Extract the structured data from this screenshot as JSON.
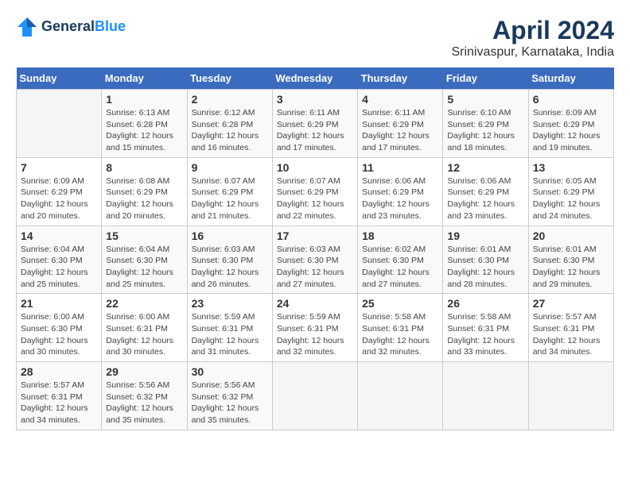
{
  "header": {
    "logo_line1": "General",
    "logo_line2": "Blue",
    "title": "April 2024",
    "subtitle": "Srinivaspur, Karnataka, India"
  },
  "calendar": {
    "days_of_week": [
      "Sunday",
      "Monday",
      "Tuesday",
      "Wednesday",
      "Thursday",
      "Friday",
      "Saturday"
    ],
    "weeks": [
      [
        {
          "day": "",
          "info": ""
        },
        {
          "day": "1",
          "info": "Sunrise: 6:13 AM\nSunset: 6:28 PM\nDaylight: 12 hours\nand 15 minutes."
        },
        {
          "day": "2",
          "info": "Sunrise: 6:12 AM\nSunset: 6:28 PM\nDaylight: 12 hours\nand 16 minutes."
        },
        {
          "day": "3",
          "info": "Sunrise: 6:11 AM\nSunset: 6:29 PM\nDaylight: 12 hours\nand 17 minutes."
        },
        {
          "day": "4",
          "info": "Sunrise: 6:11 AM\nSunset: 6:29 PM\nDaylight: 12 hours\nand 17 minutes."
        },
        {
          "day": "5",
          "info": "Sunrise: 6:10 AM\nSunset: 6:29 PM\nDaylight: 12 hours\nand 18 minutes."
        },
        {
          "day": "6",
          "info": "Sunrise: 6:09 AM\nSunset: 6:29 PM\nDaylight: 12 hours\nand 19 minutes."
        }
      ],
      [
        {
          "day": "7",
          "info": "Sunrise: 6:09 AM\nSunset: 6:29 PM\nDaylight: 12 hours\nand 20 minutes."
        },
        {
          "day": "8",
          "info": "Sunrise: 6:08 AM\nSunset: 6:29 PM\nDaylight: 12 hours\nand 20 minutes."
        },
        {
          "day": "9",
          "info": "Sunrise: 6:07 AM\nSunset: 6:29 PM\nDaylight: 12 hours\nand 21 minutes."
        },
        {
          "day": "10",
          "info": "Sunrise: 6:07 AM\nSunset: 6:29 PM\nDaylight: 12 hours\nand 22 minutes."
        },
        {
          "day": "11",
          "info": "Sunrise: 6:06 AM\nSunset: 6:29 PM\nDaylight: 12 hours\nand 23 minutes."
        },
        {
          "day": "12",
          "info": "Sunrise: 6:06 AM\nSunset: 6:29 PM\nDaylight: 12 hours\nand 23 minutes."
        },
        {
          "day": "13",
          "info": "Sunrise: 6:05 AM\nSunset: 6:29 PM\nDaylight: 12 hours\nand 24 minutes."
        }
      ],
      [
        {
          "day": "14",
          "info": "Sunrise: 6:04 AM\nSunset: 6:30 PM\nDaylight: 12 hours\nand 25 minutes."
        },
        {
          "day": "15",
          "info": "Sunrise: 6:04 AM\nSunset: 6:30 PM\nDaylight: 12 hours\nand 25 minutes."
        },
        {
          "day": "16",
          "info": "Sunrise: 6:03 AM\nSunset: 6:30 PM\nDaylight: 12 hours\nand 26 minutes."
        },
        {
          "day": "17",
          "info": "Sunrise: 6:03 AM\nSunset: 6:30 PM\nDaylight: 12 hours\nand 27 minutes."
        },
        {
          "day": "18",
          "info": "Sunrise: 6:02 AM\nSunset: 6:30 PM\nDaylight: 12 hours\nand 27 minutes."
        },
        {
          "day": "19",
          "info": "Sunrise: 6:01 AM\nSunset: 6:30 PM\nDaylight: 12 hours\nand 28 minutes."
        },
        {
          "day": "20",
          "info": "Sunrise: 6:01 AM\nSunset: 6:30 PM\nDaylight: 12 hours\nand 29 minutes."
        }
      ],
      [
        {
          "day": "21",
          "info": "Sunrise: 6:00 AM\nSunset: 6:30 PM\nDaylight: 12 hours\nand 30 minutes."
        },
        {
          "day": "22",
          "info": "Sunrise: 6:00 AM\nSunset: 6:31 PM\nDaylight: 12 hours\nand 30 minutes."
        },
        {
          "day": "23",
          "info": "Sunrise: 5:59 AM\nSunset: 6:31 PM\nDaylight: 12 hours\nand 31 minutes."
        },
        {
          "day": "24",
          "info": "Sunrise: 5:59 AM\nSunset: 6:31 PM\nDaylight: 12 hours\nand 32 minutes."
        },
        {
          "day": "25",
          "info": "Sunrise: 5:58 AM\nSunset: 6:31 PM\nDaylight: 12 hours\nand 32 minutes."
        },
        {
          "day": "26",
          "info": "Sunrise: 5:58 AM\nSunset: 6:31 PM\nDaylight: 12 hours\nand 33 minutes."
        },
        {
          "day": "27",
          "info": "Sunrise: 5:57 AM\nSunset: 6:31 PM\nDaylight: 12 hours\nand 34 minutes."
        }
      ],
      [
        {
          "day": "28",
          "info": "Sunrise: 5:57 AM\nSunset: 6:31 PM\nDaylight: 12 hours\nand 34 minutes."
        },
        {
          "day": "29",
          "info": "Sunrise: 5:56 AM\nSunset: 6:32 PM\nDaylight: 12 hours\nand 35 minutes."
        },
        {
          "day": "30",
          "info": "Sunrise: 5:56 AM\nSunset: 6:32 PM\nDaylight: 12 hours\nand 35 minutes."
        },
        {
          "day": "",
          "info": ""
        },
        {
          "day": "",
          "info": ""
        },
        {
          "day": "",
          "info": ""
        },
        {
          "day": "",
          "info": ""
        }
      ]
    ]
  }
}
